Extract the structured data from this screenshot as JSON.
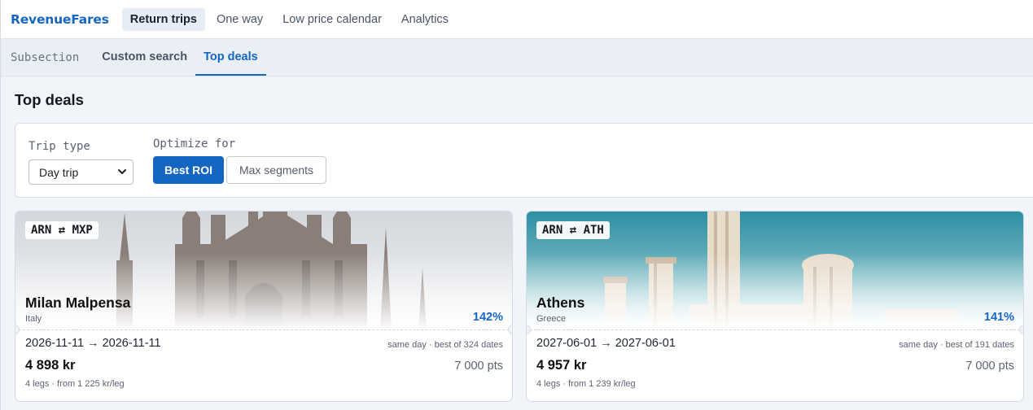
{
  "app": {
    "brand": "RevenueFares"
  },
  "nav": {
    "items": [
      {
        "label": "Return trips"
      },
      {
        "label": "One way"
      },
      {
        "label": "Low price calendar"
      },
      {
        "label": "Analytics"
      }
    ]
  },
  "subnav": {
    "label": "Subsection",
    "items": [
      {
        "label": "Custom search"
      },
      {
        "label": "Top deals"
      }
    ]
  },
  "page": {
    "title": "Top deals"
  },
  "filters": {
    "trip_type_label": "Trip type",
    "trip_type_value": "Day trip",
    "optimize_label": "Optimize for",
    "optimize_options": [
      {
        "label": "Best ROI"
      },
      {
        "label": "Max segments"
      }
    ]
  },
  "deals": [
    {
      "route": "ARN ⇄ MXP",
      "city": "Milan Malpensa",
      "country": "Italy",
      "roi": "142%",
      "dates": "2026-11-11 → 2026-11-11",
      "date_meta": "same day · best of 324 dates",
      "price": "4 898 kr",
      "points": "7 000 pts",
      "legs": "4 legs · from 1 225 kr/leg"
    },
    {
      "route": "ARN ⇄ ATH",
      "city": "Athens",
      "country": "Greece",
      "roi": "141%",
      "dates": "2027-06-01 → 2027-06-01",
      "date_meta": "same day · best of 191 dates",
      "price": "4 957 kr",
      "points": "7 000 pts",
      "legs": "4 legs · from 1 239 kr/leg"
    }
  ]
}
